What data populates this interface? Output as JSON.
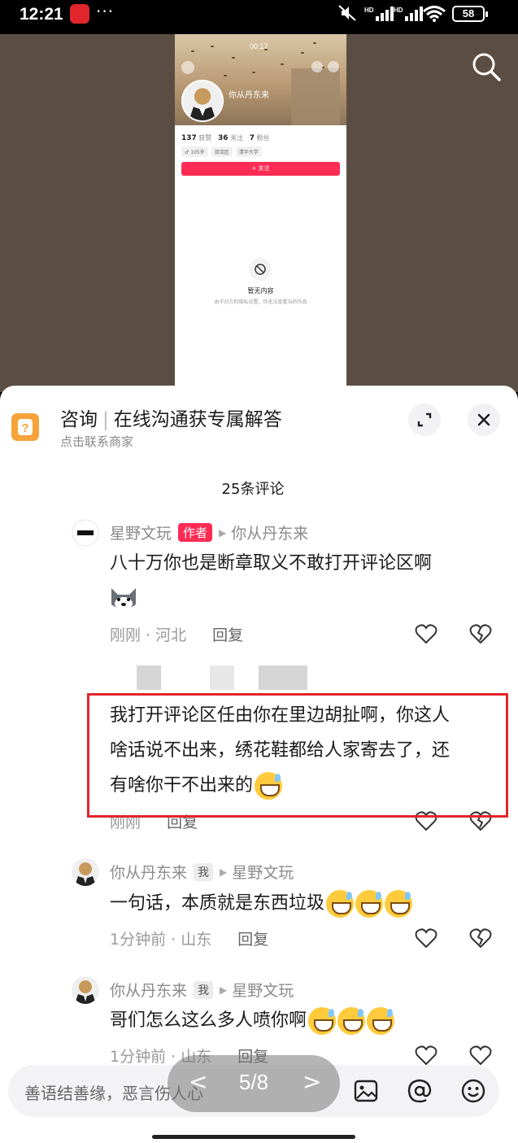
{
  "status_bar": {
    "time": "12:21",
    "app_badge": "淘",
    "more": "···",
    "network1": "HD",
    "network2": "HD",
    "battery": "58"
  },
  "screenshot": {
    "time": "00:17",
    "profile_name": "你从丹东来",
    "likes_value": "137",
    "likes_label": "获赞",
    "following_value": "36",
    "following_label": "关注",
    "followers_value": "7",
    "followers_label": "粉丝",
    "tags": [
      "♂ 105岁",
      "双流区",
      "清华大学"
    ],
    "follow_button": "+ 关注",
    "empty_title": "暂无内容",
    "empty_desc": "由于对方的隐私设置，你无法查看Ta的作品"
  },
  "consult": {
    "icon_glyph": "?",
    "title_main": "咨询",
    "title_rest": "在线沟通获专属解答",
    "subtitle": "点击联系商家"
  },
  "comments_header": "25条评论",
  "comments": [
    {
      "user": "星野文玩",
      "badge": "作者",
      "reply_to": "你从丹东来",
      "text": "八十万你也是断章取义不敢打开评论区啊",
      "time_loc": "刚刚 · 河北",
      "reply": "回复"
    },
    {
      "text_line1": "我打开评论区任由你在里边胡扯啊，你这人",
      "text_line2": "啥话说不出来，绣花鞋都给人家寄去了，还",
      "text_line3": "有啥你干不出来的",
      "time_loc": "刚刚",
      "reply": "回复"
    },
    {
      "user": "你从丹东来",
      "badge": "我",
      "reply_to": "星野文玩",
      "text": "一句话，本质就是东西垃圾",
      "time_loc": "1分钟前 · 山东",
      "reply": "回复"
    },
    {
      "user": "你从丹东来",
      "badge": "我",
      "reply_to": "星野文玩",
      "text": "哥们怎么这么多人喷你啊",
      "time_loc": "1分钟前 · 山东",
      "reply": "回复"
    }
  ],
  "input": {
    "placeholder": "善语结善缘，恶言伤人心"
  },
  "pager": {
    "prev": "<",
    "label": "5/8",
    "next": ">"
  },
  "icons": {
    "search": "search-icon",
    "expand": "expand-icon",
    "close": "close-icon",
    "heart": "heart-icon",
    "dislike": "broken-heart-icon",
    "image": "image-icon",
    "mention": "at-icon",
    "emoji": "emoji-icon"
  },
  "colors": {
    "accent": "#fe2c55",
    "highlight": "#e3242b",
    "consult": "#f5a33a"
  }
}
